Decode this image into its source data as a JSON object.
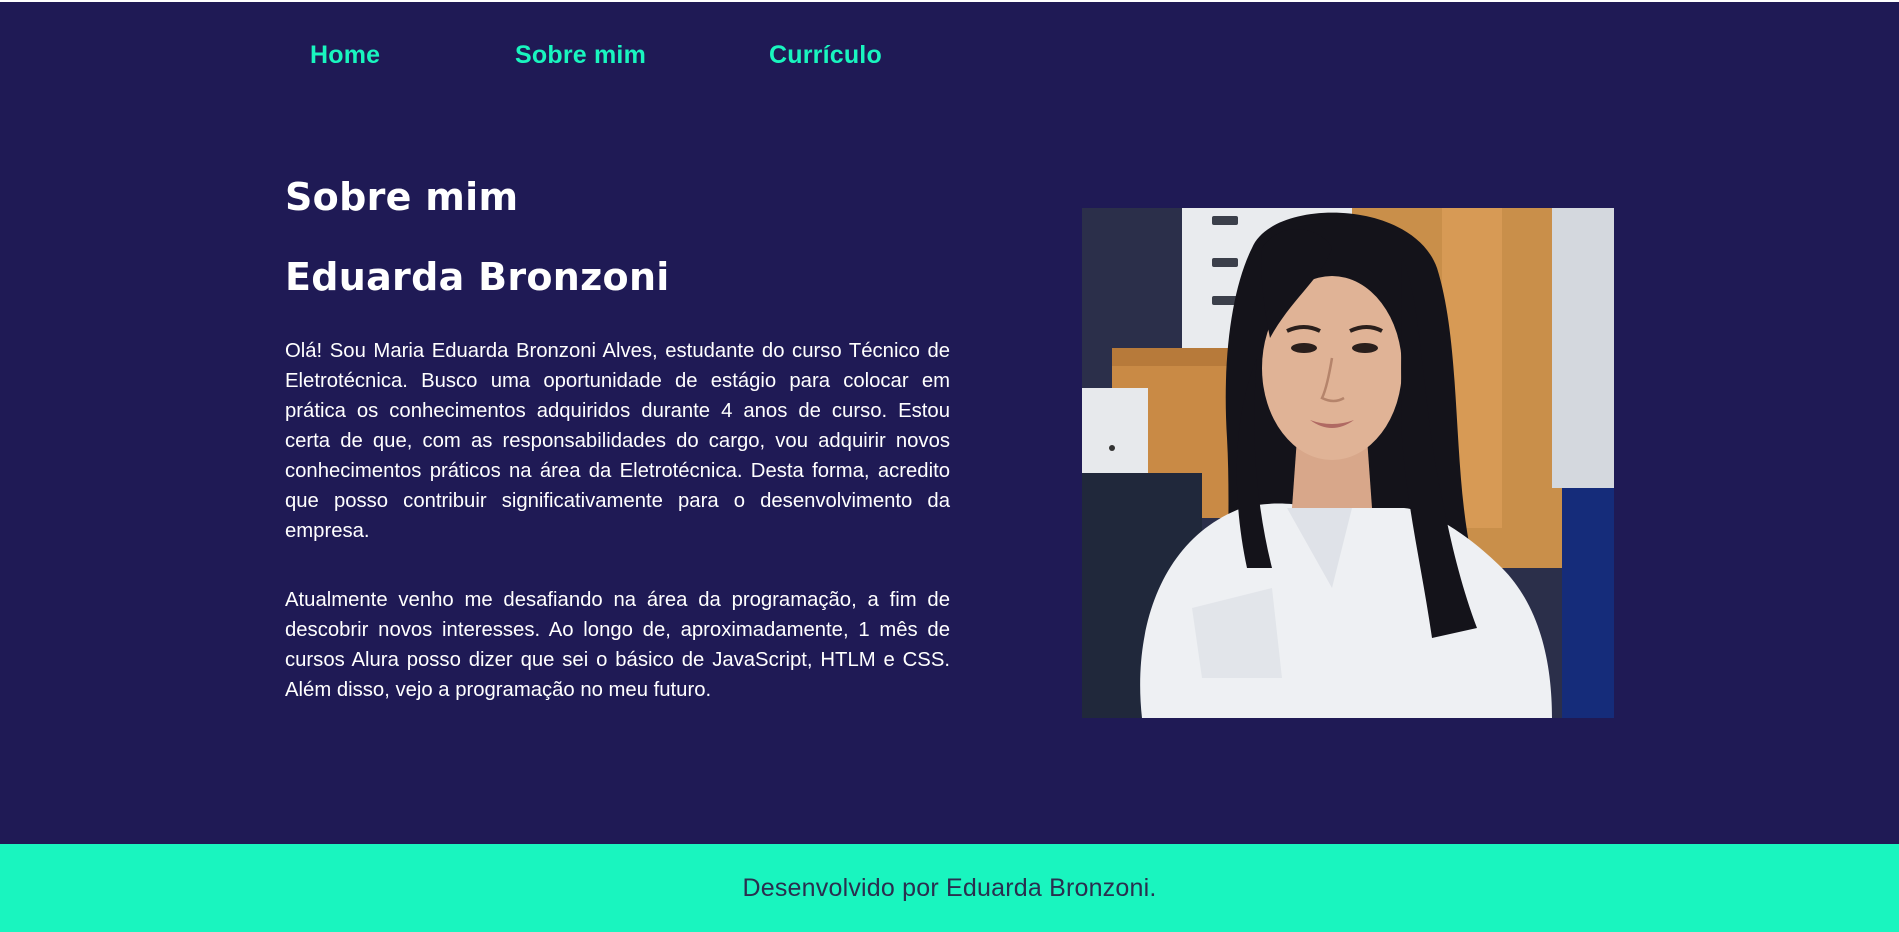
{
  "nav": {
    "items": [
      {
        "label": "Home"
      },
      {
        "label": "Sobre mim"
      },
      {
        "label": "Currículo"
      }
    ]
  },
  "main": {
    "title": "Sobre mim",
    "name": "Eduarda Bronzoni",
    "paragraphs": [
      "Olá! Sou Maria Eduarda Bronzoni Alves, estudante do curso Técnico de Eletrotécnica. Busco uma oportunidade de estágio para colocar em prática os conhecimentos adquiridos durante 4 anos de curso. Estou certa de que, com as responsabilidades do cargo, vou adquirir novos conhecimentos práticos na área da Eletrotécnica. Desta forma, acredito que posso contribuir significativamente para o desenvolvimento da empresa.",
      "Atualmente venho me desafiando na área da programação, a fim de descobrir novos interesses. Ao longo de, aproximadamente, 1 mês de cursos Alura posso dizer que sei o básico de JavaScript, HTLM e CSS. Além disso, vejo a programação no meu futuro."
    ]
  },
  "footer": {
    "text": "Desenvolvido por Eduarda Bronzoni."
  },
  "colors": {
    "background": "#1f1a55",
    "accent": "#19f5bf",
    "text": "#ffffff",
    "footer_text": "#2a2f4f"
  }
}
